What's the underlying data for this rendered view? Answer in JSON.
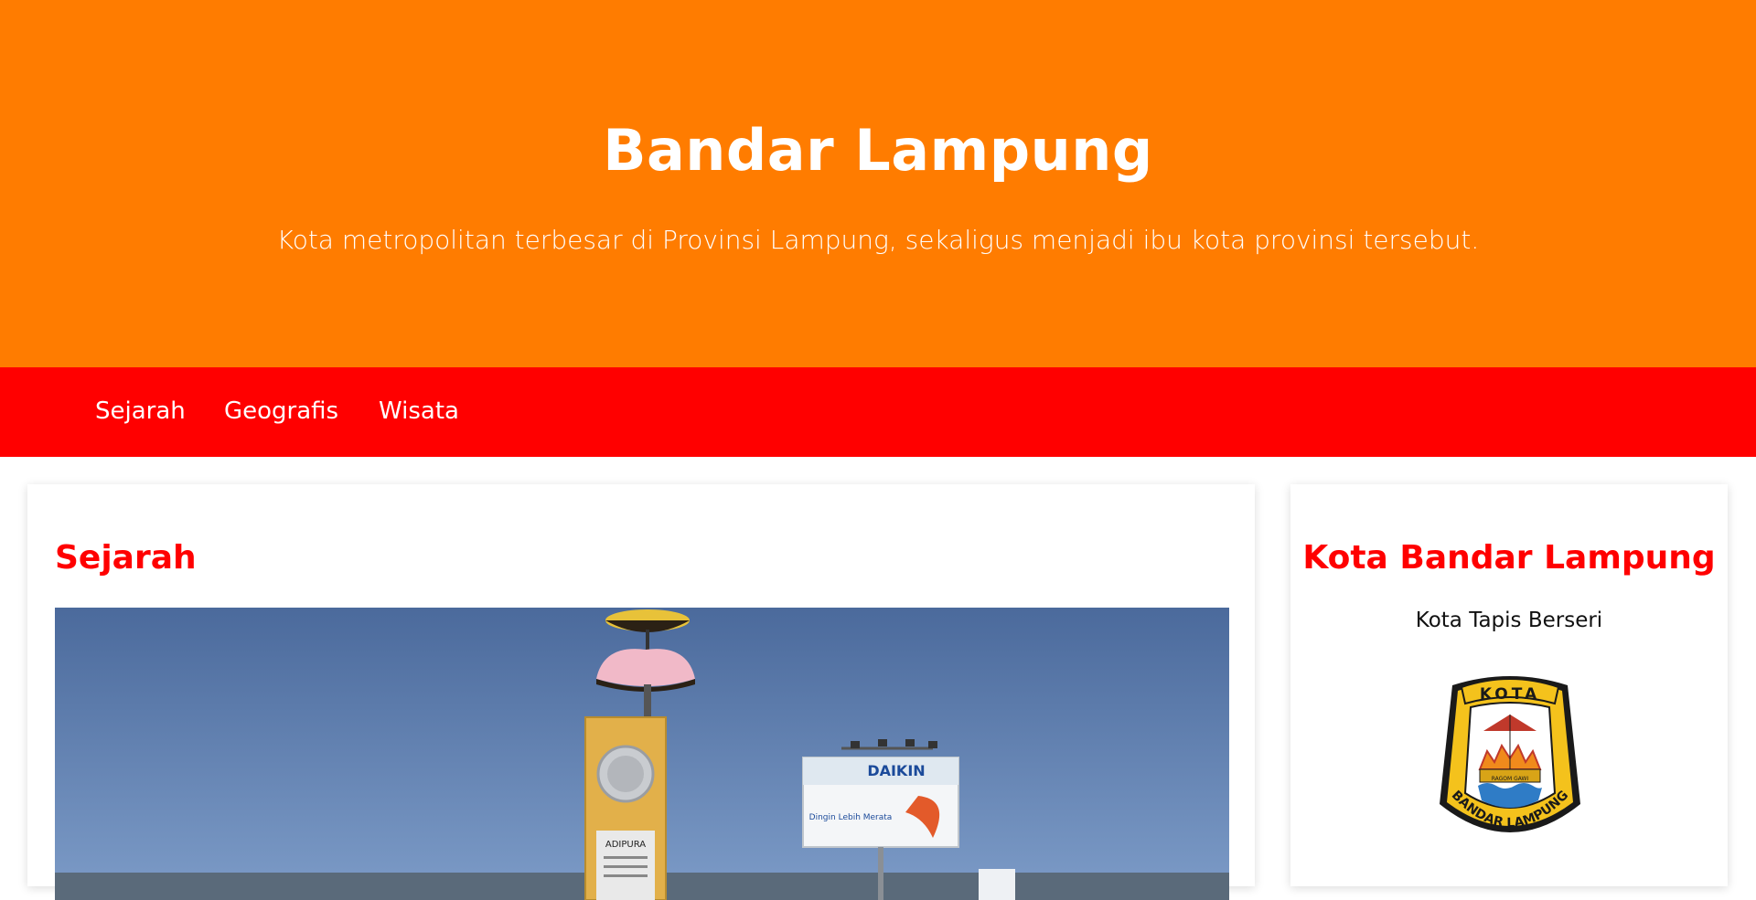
{
  "hero": {
    "title": "Bandar Lampung",
    "subtitle": "Kota metropolitan terbesar di Provinsi Lampung, sekaligus menjadi ibu kota provinsi tersebut."
  },
  "nav": {
    "items": [
      {
        "label": "Sejarah"
      },
      {
        "label": "Geografis"
      },
      {
        "label": "Wisata"
      }
    ]
  },
  "main": {
    "section_title": "Sejarah",
    "image": {
      "monument_text": "ADIPURA",
      "billboard_brand": "DAIKIN",
      "billboard_tagline": "Dingin Lebih Merata"
    }
  },
  "sidebar": {
    "title": "Kota Bandar Lampung",
    "subtitle": "Kota Tapis Berseri",
    "emblem": {
      "top_text": "KOTA",
      "bottom_text": "BANDAR LAMPUNG",
      "motto": "RAGOM GAWI"
    }
  },
  "colors": {
    "hero_bg": "#ff7c00",
    "nav_bg": "#ff0000",
    "heading_red": "#ff0000"
  }
}
